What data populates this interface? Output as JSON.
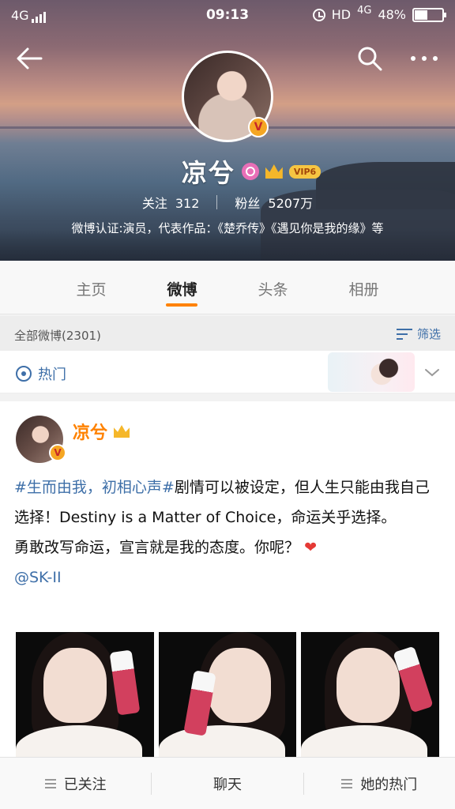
{
  "status_bar": {
    "network": "4G",
    "time": "09:13",
    "hd_label": "HD",
    "network2": "4G",
    "battery": "48%",
    "battery_level": 0.48
  },
  "profile": {
    "name": "凉兮",
    "vip_badge": "VIP6",
    "following_label": "关注",
    "following_count": "312",
    "followers_label": "粉丝",
    "followers_count": "5207万",
    "bio": "微博认证:演员，代表作品：《楚乔传》《遇见你是我的缘》等",
    "verified_mark": "V"
  },
  "tabs": [
    {
      "label": "主页",
      "active": false
    },
    {
      "label": "微博",
      "active": true
    },
    {
      "label": "头条",
      "active": false
    },
    {
      "label": "相册",
      "active": false
    }
  ],
  "filter": {
    "count_label": "全部微博(2301)",
    "filter_label": "筛选"
  },
  "hot": {
    "label": "热门"
  },
  "post": {
    "author": "凉兮",
    "hashtag": "#生而由我，初相心声#",
    "text_1": "剧情可以被设定，但人生只能由我自己选择！Destiny is a Matter of Choice，命运关乎选择。",
    "text_2": "勇敢改写命运，宣言就是我的态度。你呢？",
    "heart": "❤",
    "mention": "@SK-II"
  },
  "bottom_bar": {
    "followed_label": "已关注",
    "chat_label": "聊天",
    "hot_label": "她的热门"
  },
  "colors": {
    "accent": "#ff8200",
    "link": "#3e6fa8",
    "heart": "#e53935"
  },
  "icons": [
    "back-arrow-icon",
    "search-icon",
    "more-icon",
    "alarm-icon",
    "battery-icon",
    "signal-icon",
    "filter-icon",
    "hot-icon",
    "chevron-down-icon",
    "crown-icon",
    "menu-icon"
  ]
}
